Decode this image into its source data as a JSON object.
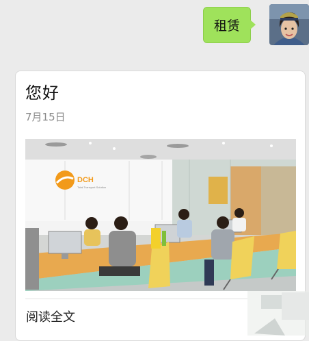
{
  "chat": {
    "message_text": "租赁"
  },
  "article": {
    "title": "您好",
    "date": "7月15日",
    "read_more": "阅读全文",
    "cover_logo_text": "DCH",
    "cover_logo_tagline": "Total Transport Solution"
  }
}
